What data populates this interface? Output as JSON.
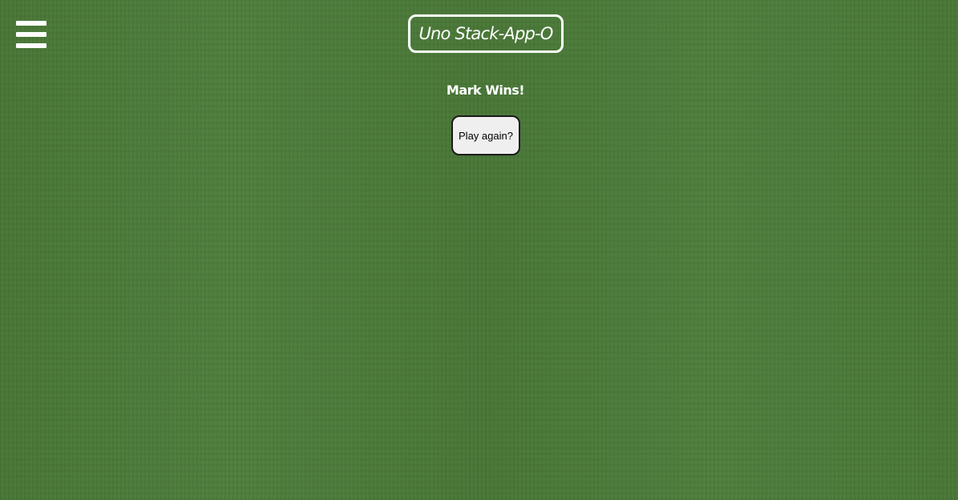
{
  "header": {
    "menu_icon": "hamburger-menu-icon",
    "title": "Uno Stack-App-O"
  },
  "main": {
    "result_message": "Mark Wins!",
    "play_again_label": "Play again?"
  },
  "colors": {
    "background": "#4a7a38",
    "text": "#ffffff",
    "button_bg": "#efefef",
    "button_border": "#1b1b1b"
  }
}
